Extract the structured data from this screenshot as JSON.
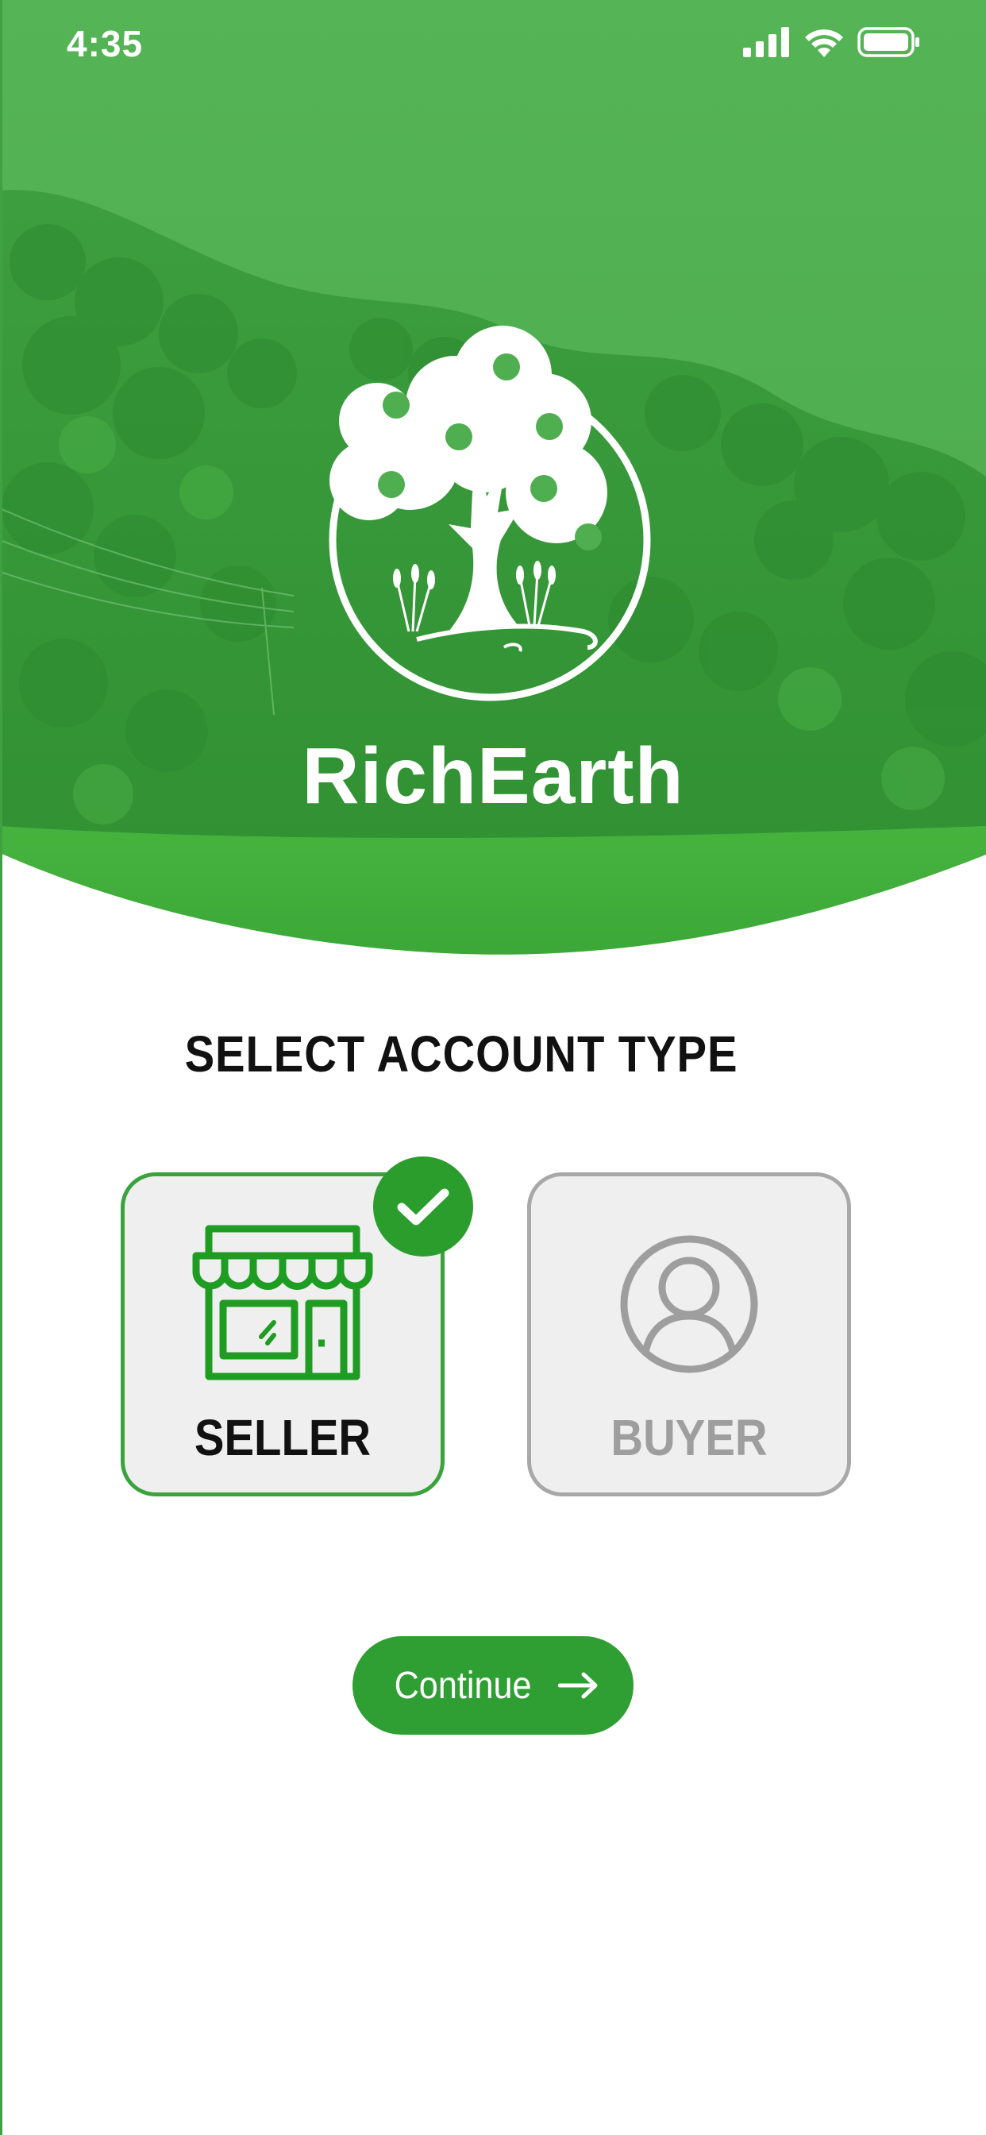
{
  "status_bar": {
    "time": "4:35",
    "icons": [
      "cellular-signal-icon",
      "wifi-icon",
      "battery-icon"
    ]
  },
  "brand": {
    "name": "RichEarth",
    "logo_icon": "tree-logo-icon"
  },
  "main": {
    "title": "SELECT ACCOUNT TYPE",
    "account_types": [
      {
        "label": "SELLER",
        "icon": "storefront-icon",
        "selected": true
      },
      {
        "label": "BUYER",
        "icon": "user-profile-icon",
        "selected": false
      }
    ],
    "continue_label": "Continue"
  },
  "colors": {
    "primary_green": "#2f9e33",
    "selected_border": "#3aa33d",
    "unselected_border": "#a8a8a8",
    "card_background": "#efefef",
    "unselected_text": "#9e9e9e"
  }
}
